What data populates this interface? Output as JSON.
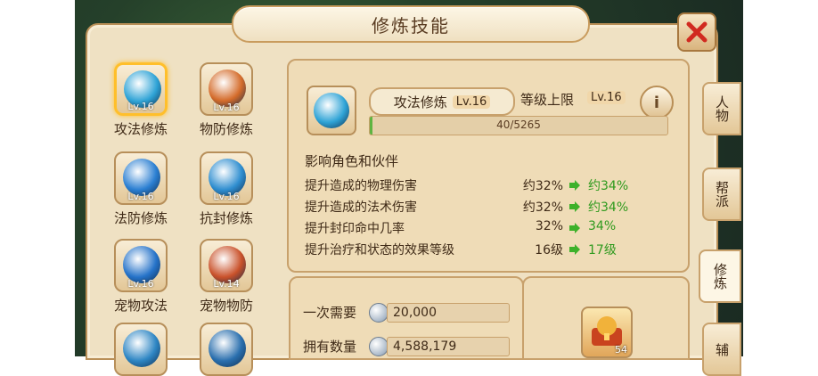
{
  "window": {
    "title": "修炼技能"
  },
  "skills": [
    {
      "name": "攻法修炼",
      "level": "Lv.16",
      "selected": true,
      "color": "#2ea3d6"
    },
    {
      "name": "物防修炼",
      "level": "Lv.16",
      "selected": false,
      "color": "#d46b2a"
    },
    {
      "name": "法防修炼",
      "level": "Lv.16",
      "selected": false,
      "color": "#2b7fd2"
    },
    {
      "name": "抗封修炼",
      "level": "Lv.16",
      "selected": false,
      "color": "#2f8ed0"
    },
    {
      "name": "宠物攻法",
      "level": "Lv.16",
      "selected": false,
      "color": "#2673c9"
    },
    {
      "name": "宠物物防",
      "level": "Lv.14",
      "selected": false,
      "color": "#c9512a"
    },
    {
      "name": "",
      "level": "",
      "selected": false,
      "color": "#2e86c4"
    },
    {
      "name": "",
      "level": "",
      "selected": false,
      "color": "#2a6fae"
    }
  ],
  "detail": {
    "skill_name": "攻法修炼",
    "skill_level": "Lv.16",
    "cap_label": "等级上限",
    "cap_level": "Lv.16",
    "info_label": "i",
    "progress_text": "40/5265",
    "progress_fraction": 0.0076,
    "section_title": "影响角色和伙伴",
    "effects": [
      {
        "label": "提升造成的物理伤害",
        "from": "约32%",
        "to": "约34%"
      },
      {
        "label": "提升造成的法术伤害",
        "from": "约32%",
        "to": "约34%"
      },
      {
        "label": "提升封印命中几率",
        "from": "32%",
        "to": "34%"
      },
      {
        "label": "提升治疗和状态的效果等级",
        "from": "16级",
        "to": "17级"
      }
    ]
  },
  "tabs": [
    {
      "label": "人物"
    },
    {
      "label": "帮派"
    },
    {
      "label": "修炼",
      "active": true
    },
    {
      "label": "辅"
    }
  ],
  "cost": {
    "once_label": "一次需要",
    "once_value": "20,000",
    "owned_label": "拥有数量",
    "owned_value": "4,588,179"
  },
  "item": {
    "count": "54"
  },
  "colors": {
    "accent": "#ffbf2b",
    "gain": "#2f9a1e",
    "progress": "#5fb441"
  }
}
